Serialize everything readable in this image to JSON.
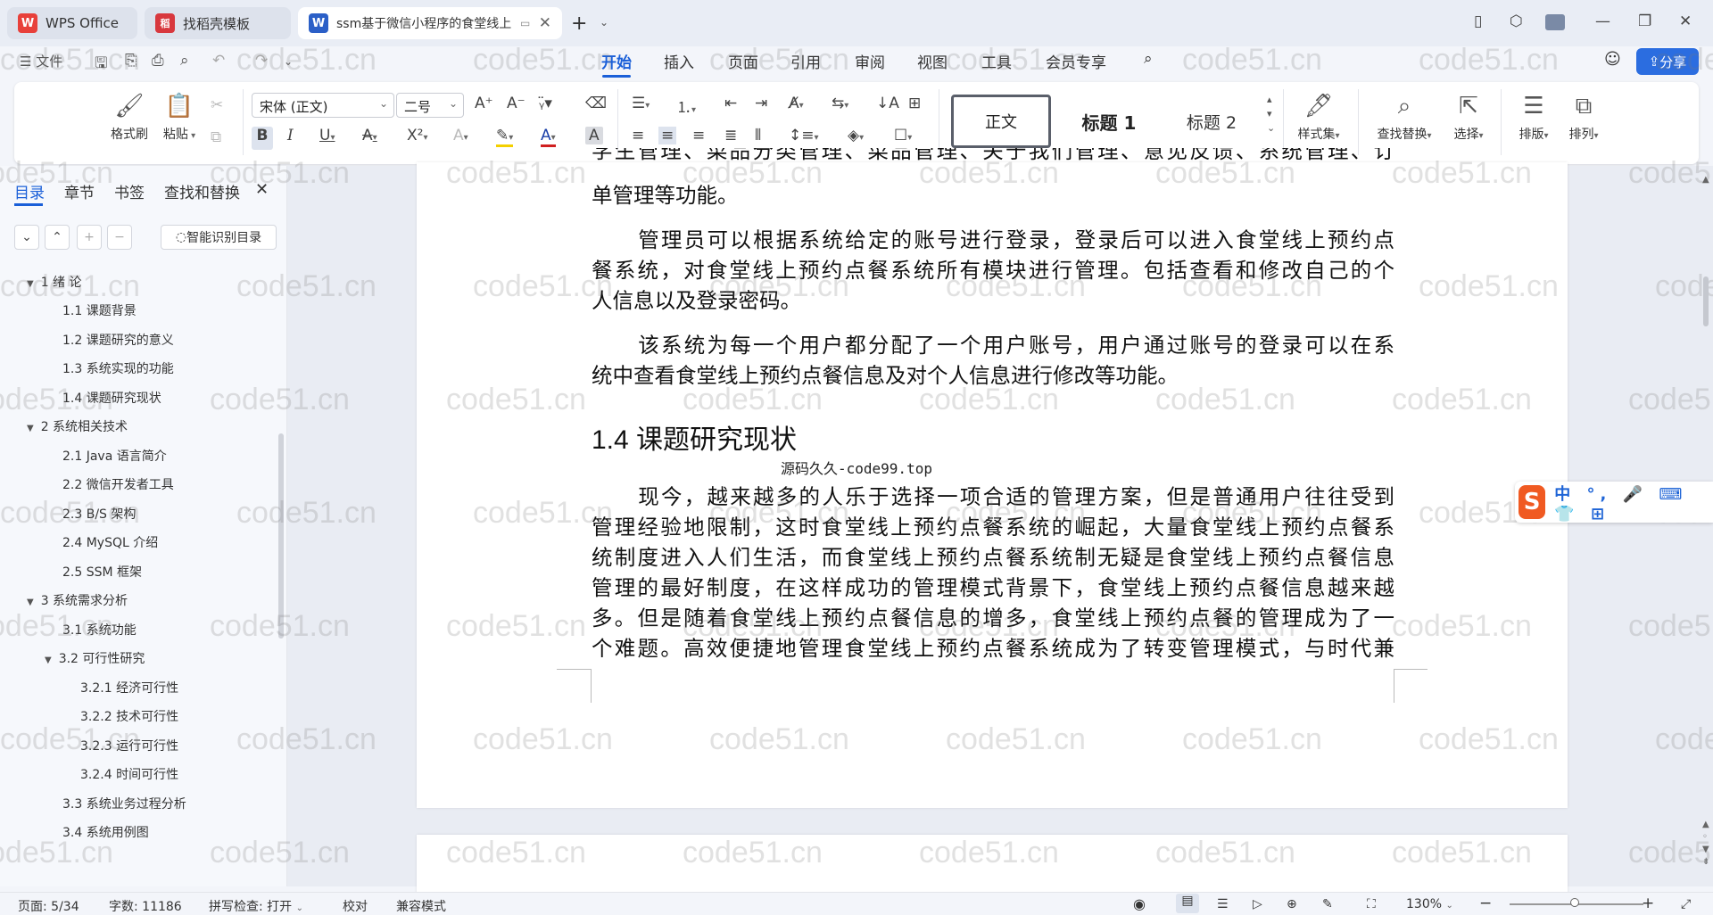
{
  "tabs": [
    {
      "label": "WPS Office",
      "logo": "W"
    },
    {
      "label": "找稻壳模板",
      "logo": "稻"
    },
    {
      "label": "ssm基于微信小程序的食堂线上",
      "logo": "W"
    }
  ],
  "menu": {
    "file": "文件",
    "items": [
      "开始",
      "插入",
      "页面",
      "引用",
      "审阅",
      "视图",
      "工具",
      "会员专享"
    ],
    "active": "开始",
    "share": "分享"
  },
  "ribbon": {
    "format_painter": "格式刷",
    "paste": "粘贴",
    "font_name": "宋体 (正文)",
    "font_size": "二号",
    "styles": [
      "正文",
      "标题 1",
      "标题 2"
    ],
    "style_set": "样式集",
    "find_replace": "查找替换",
    "select": "选择",
    "layout": "排版",
    "arrange": "排列"
  },
  "nav": {
    "tabs": [
      "目录",
      "章节",
      "书签",
      "查找和替换"
    ],
    "smart_toc": "智能识别目录",
    "toc": [
      {
        "label": "1 绪  论",
        "level": 1,
        "expanded": true
      },
      {
        "label": "1.1 课题背景",
        "level": 2
      },
      {
        "label": "1.2 课题研究的意义",
        "level": 2
      },
      {
        "label": "1.3 系统实现的功能",
        "level": 2
      },
      {
        "label": "1.4 课题研究现状",
        "level": 2
      },
      {
        "label": "2 系统相关技术",
        "level": 1,
        "expanded": true
      },
      {
        "label": "2.1 Java 语言简介",
        "level": 2
      },
      {
        "label": "2.2 微信开发者工具",
        "level": 2
      },
      {
        "label": "2.3 B/S 架构",
        "level": 2
      },
      {
        "label": "2.4 MySQL  介绍",
        "level": 2
      },
      {
        "label": "2.5 SSM 框架",
        "level": 2
      },
      {
        "label": "3 系统需求分析",
        "level": 1,
        "expanded": true
      },
      {
        "label": "3.1 系统功能",
        "level": 2
      },
      {
        "label": "3.2 可行性研究",
        "level": 2,
        "expanded": true
      },
      {
        "label": "3.2.1  经济可行性",
        "level": 3
      },
      {
        "label": "3.2.2  技术可行性",
        "level": 3
      },
      {
        "label": "3.2.3  运行可行性",
        "level": 3
      },
      {
        "label": "3.2.4  时间可行性",
        "level": 3
      },
      {
        "label": "3.3 系统业务过程分析",
        "level": 2
      },
      {
        "label": "3.4 系统用例图",
        "level": 2
      }
    ]
  },
  "doc": {
    "para0_top_cut": "学生管理、菜品分类管理、菜品管理、关于我们管理、意见反馈、系统管理、订",
    "para0_last": "单管理等功能。",
    "para1": [
      "管理员可以根据系统给定的账号进行登录，登录后可以进入食堂线上预约点",
      "餐系统，对食堂线上预约点餐系统所有模块进行管理。包括查看和修改自己的个",
      "人信息以及登录密码。"
    ],
    "para2": [
      "该系统为每一个用户都分配了一个用户账号，用户通过账号的登录可以在系",
      "统中查看食堂线上预约点餐信息及对个人信息进行修改等功能。"
    ],
    "heading": "1.4  课题研究现状",
    "caption": "源码久久-code99.top",
    "para3": [
      "现今，越来越多的人乐于选择一项合适的管理方案，但是普通用户往往受到",
      "管理经验地限制，这时食堂线上预约点餐系统的崛起，大量食堂线上预约点餐系",
      "统制度进入人们生活，而食堂线上预约点餐系统制无疑是食堂线上预约点餐信息",
      "管理的最好制度，在这样成功的管理模式背景下，食堂线上预约点餐信息越来越",
      "多。但是随着食堂线上预约点餐信息的增多，食堂线上预约点餐的管理成为了一",
      "个难题。高效便捷地管理食堂线上预约点餐系统成为了转变管理模式，与时代兼"
    ]
  },
  "watermark": "code51.cn",
  "ime": {
    "logo": "S",
    "text": "中 °, 🎤 ⌨ 👕 ⊞"
  },
  "status": {
    "page": "页面: 5/34",
    "words": "字数: 11186",
    "spell": "拼写检查: 打开",
    "proof": "校对",
    "compat": "兼容模式",
    "zoom": "130%"
  },
  "colors": {
    "accent": "#1a5fd8",
    "wps_red": "#e8403a",
    "template_red": "#d8383e",
    "writer_blue": "#2b5fc7",
    "ime_orange": "#f05a22"
  }
}
